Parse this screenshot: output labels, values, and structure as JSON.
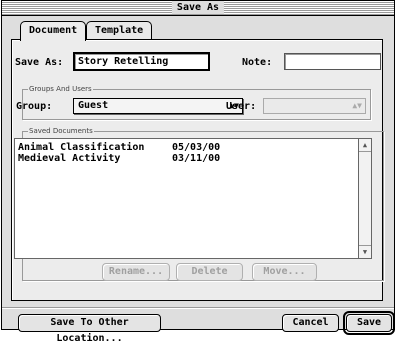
{
  "window": {
    "title": "Save As"
  },
  "tabs": [
    {
      "label": "Document",
      "active": true
    },
    {
      "label": "Template",
      "active": false
    }
  ],
  "save_as": {
    "label": "Save As:",
    "value": "Story Retelling"
  },
  "note": {
    "label": "Note:",
    "value": ""
  },
  "groups": {
    "title": "Groups And Users",
    "group_label": "Group:",
    "group_value": "Guest",
    "user_label": "User:",
    "user_value": ""
  },
  "saved": {
    "title": "Saved Documents",
    "items": [
      {
        "name": "Animal Classification",
        "date": "05/03/00"
      },
      {
        "name": "Medieval Activity",
        "date": "03/11/00"
      }
    ]
  },
  "actions": {
    "rename": "Rename...",
    "delete": "Delete",
    "move": "Move..."
  },
  "footer": {
    "other_location": "Save To Other Location...",
    "cancel": "Cancel",
    "save": "Save"
  },
  "icons": {
    "popup_arrow": "up-down-arrows-icon",
    "scroll_up": "scroll-up-arrow-icon",
    "scroll_down": "scroll-down-arrow-icon"
  }
}
